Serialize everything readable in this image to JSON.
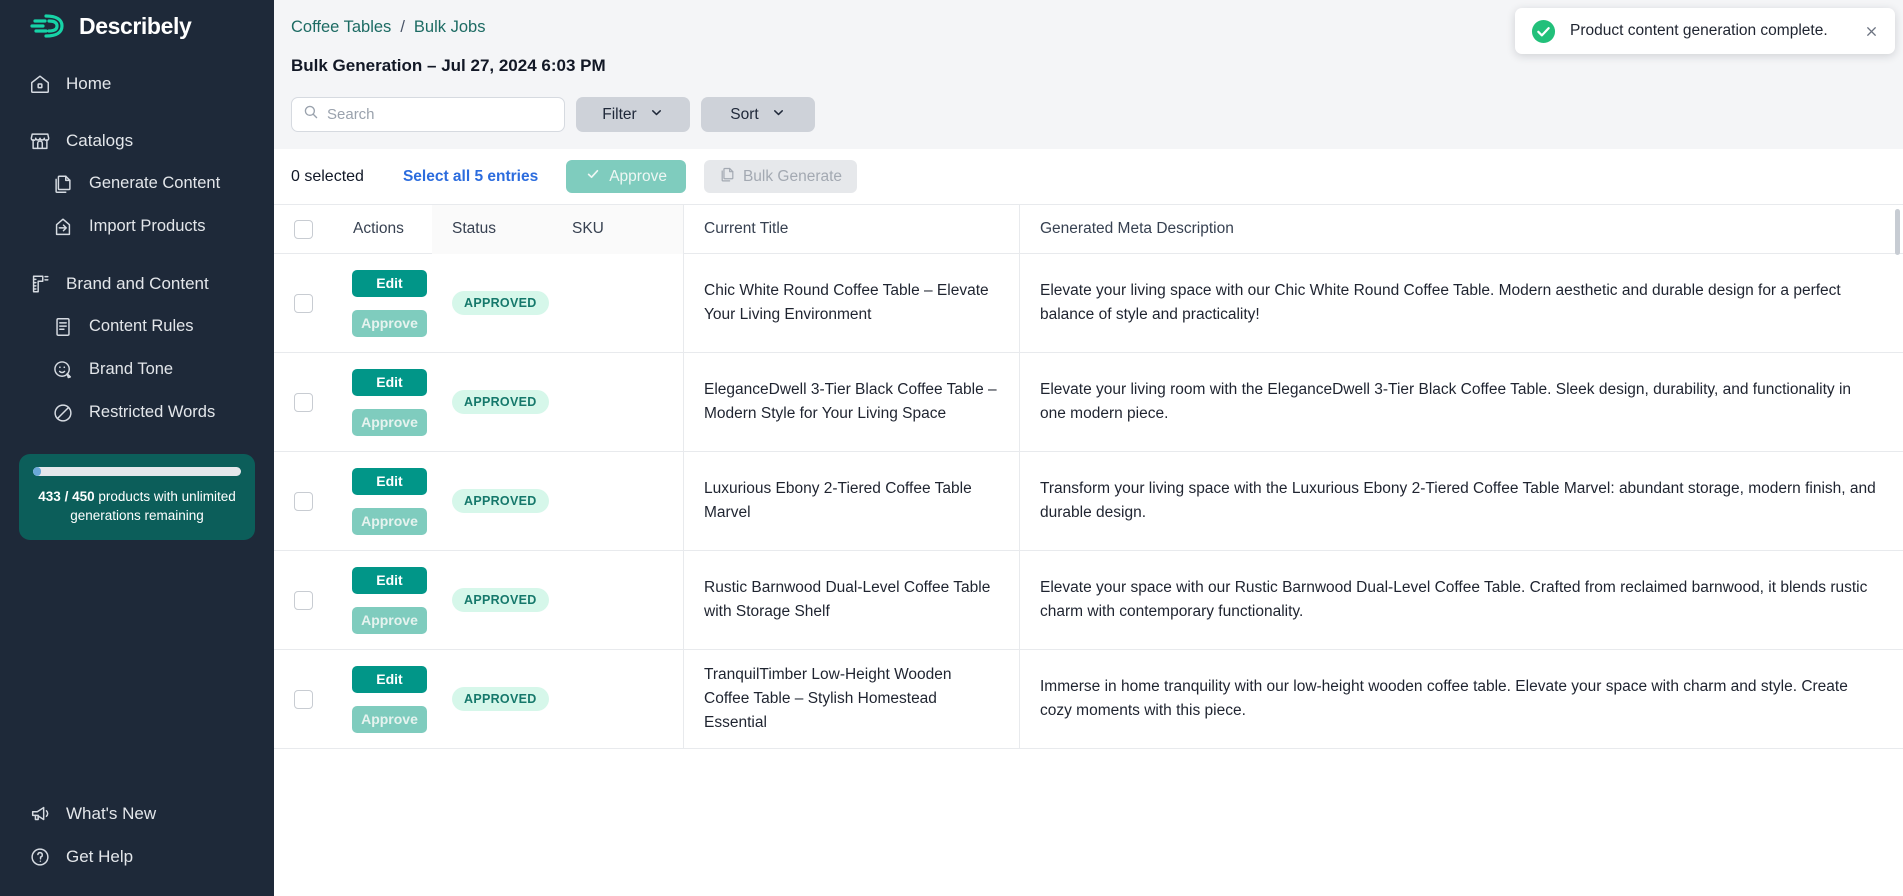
{
  "brand": {
    "name": "Describely",
    "logo_icon": "describely-logo"
  },
  "sidebar": {
    "items": [
      {
        "label": "Home",
        "icon": "home-icon",
        "level": "top",
        "key": "home"
      },
      {
        "label": "Catalogs",
        "icon": "storefront-icon",
        "level": "top",
        "key": "catalogs"
      },
      {
        "label": "Generate Content",
        "icon": "copy-document-icon",
        "level": "sub",
        "key": "generate-content"
      },
      {
        "label": "Import Products",
        "icon": "import-arrow-icon",
        "level": "sub",
        "key": "import-products"
      },
      {
        "label": "Brand and Content",
        "icon": "ruler-icon",
        "level": "top",
        "key": "brand-and-content"
      },
      {
        "label": "Content Rules",
        "icon": "document-lines-icon",
        "level": "sub",
        "key": "content-rules"
      },
      {
        "label": "Brand Tone",
        "icon": "smiley-pencil-icon",
        "level": "sub",
        "key": "brand-tone"
      },
      {
        "label": "Restricted Words",
        "icon": "no-entry-icon",
        "level": "sub",
        "key": "restricted-words"
      }
    ],
    "quota": {
      "used": "433",
      "separator": "/",
      "total": "450",
      "text": "products with unlimited generations remaining",
      "percent": 4,
      "bar_color": "#6aa8d8",
      "card_color": "#0c5e5a"
    },
    "bottom_items": [
      {
        "label": "What's New",
        "icon": "megaphone-icon",
        "key": "whats-new"
      },
      {
        "label": "Get Help",
        "icon": "question-circle-icon",
        "key": "get-help"
      }
    ]
  },
  "breadcrumb": {
    "parent": "Coffee Tables",
    "separator": "/",
    "current": "Bulk Jobs",
    "color": "#1c6b63"
  },
  "page": {
    "title": "Bulk Generation – Jul 27, 2024 6:03 PM"
  },
  "toolbar": {
    "search": {
      "placeholder": "Search",
      "value": "",
      "icon": "search-icon"
    },
    "filter": {
      "label": "Filter",
      "icon": "chevron-down-icon"
    },
    "sort": {
      "label": "Sort",
      "icon": "chevron-down-icon"
    }
  },
  "selection_bar": {
    "count_label": "0 selected",
    "select_all_label": "Select all 5 entries",
    "select_all_color": "#2b6cde",
    "approve_label": "Approve",
    "approve_icon": "check-icon",
    "bulk_generate_label": "Bulk Generate",
    "bulk_generate_icon": "copy-document-icon"
  },
  "table": {
    "columns": [
      "",
      "Actions",
      "Status",
      "SKU",
      "Current Title",
      "Generated Meta Description"
    ],
    "row_action_edit": "Edit",
    "row_action_approve": "Approve",
    "rows": [
      {
        "status": "APPROVED",
        "sku": "",
        "title": "Chic White Round Coffee Table – Elevate Your Living Environment",
        "meta": "Elevate your living space with our Chic White Round Coffee Table. Modern aesthetic and durable design for a perfect balance of style and practicality!"
      },
      {
        "status": "APPROVED",
        "sku": "",
        "title": "EleganceDwell 3-Tier Black Coffee Table – Modern Style for Your Living Space",
        "meta": "Elevate your living room with the EleganceDwell 3-Tier Black Coffee Table. Sleek design, durability, and functionality in one modern piece."
      },
      {
        "status": "APPROVED",
        "sku": "",
        "title": "Luxurious Ebony 2-Tiered Coffee Table Marvel",
        "meta": "Transform your living space with the Luxurious Ebony 2-Tiered Coffee Table Marvel: abundant storage, modern finish, and durable design."
      },
      {
        "status": "APPROVED",
        "sku": "",
        "title": "Rustic Barnwood Dual-Level Coffee Table with Storage Shelf",
        "meta": "Elevate your space with our Rustic Barnwood Dual-Level Coffee Table. Crafted from reclaimed barnwood, it blends rustic charm with contemporary functionality."
      },
      {
        "status": "APPROVED",
        "sku": "",
        "title": "TranquilTimber Low-Height Wooden Coffee Table – Stylish Homestead Essential",
        "meta": "Immerse in home tranquility with our low-height wooden coffee table. Elevate your space with charm and style. Create cozy moments with this piece."
      }
    ]
  },
  "toast": {
    "message": "Product content generation complete.",
    "status_icon": "success-check-circle-icon",
    "close_icon": "close-icon",
    "accent": "#22c07a"
  }
}
